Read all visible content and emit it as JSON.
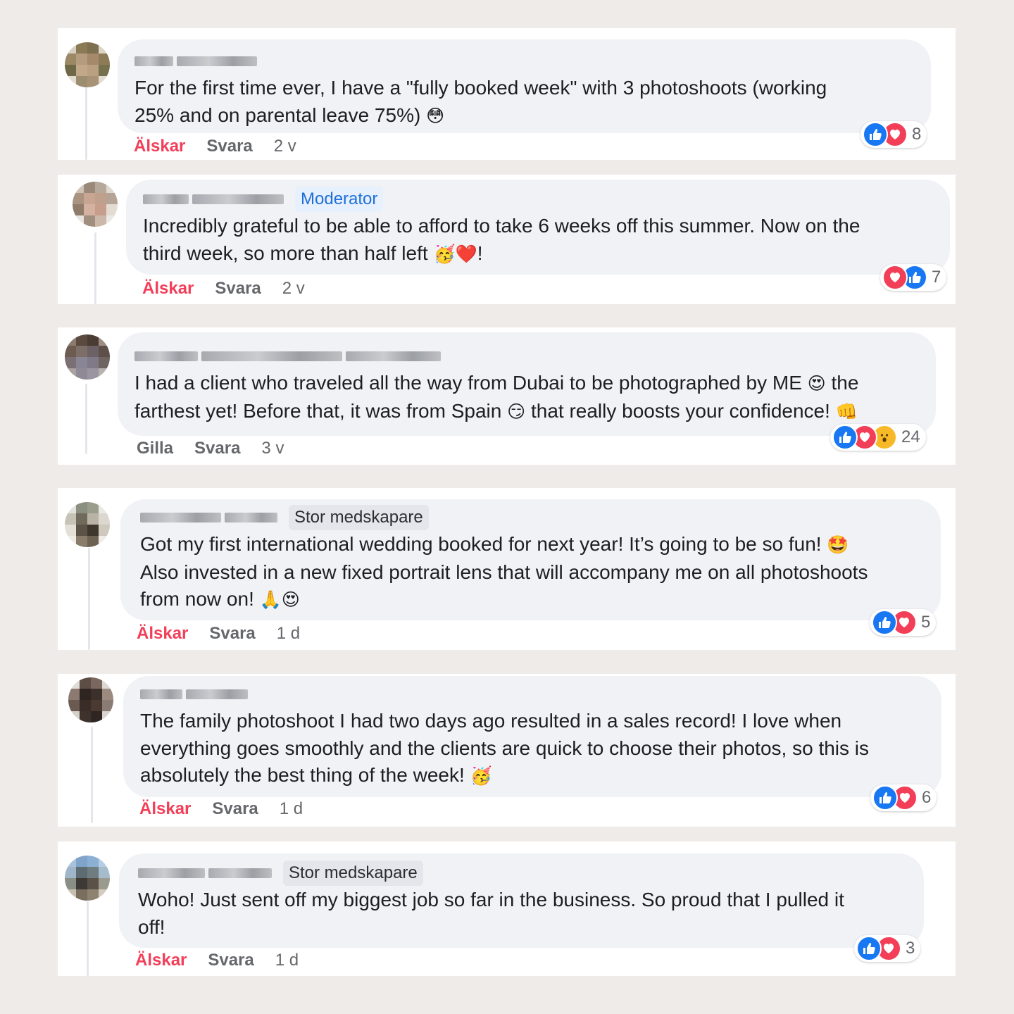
{
  "labels": {
    "love": "Älskar",
    "like": "Gilla",
    "reply": "Svara"
  },
  "colors": {
    "page_bg": "#efebe9",
    "bubble_bg": "#f0f2f5",
    "love_text": "#f33e58",
    "like_blue": "#1877f2",
    "moderator_text": "#1e6fd9"
  },
  "comments": [
    {
      "badge": "",
      "line1": "For the first time ever, I have a \"fully booked week\" with 3 photoshoots (working",
      "line2": "25% and on parental leave 75%)",
      "line3": "",
      "emoji": [
        "😳"
      ],
      "action": "Älskar",
      "time": "2 v",
      "reaction_icons": [
        "like-icon",
        "heart-icon"
      ],
      "reaction_count": "8"
    },
    {
      "badge": "Moderator",
      "line1": "Incredibly grateful to be able to afford to take 6 weeks off this summer. Now on the",
      "line2": "third week, so more than half left",
      "line3": "",
      "emoji": [
        "🥳",
        "❤️"
      ],
      "trailing": "!",
      "action": "Älskar",
      "time": "2 v",
      "reaction_icons": [
        "heart-icon",
        "like-icon"
      ],
      "reaction_count": "7"
    },
    {
      "badge": "",
      "line1a": "I had a client who traveled all the way from Dubai to be photographed by ME",
      "line1b": "the",
      "line2a": "farthest yet! Before that, it was from Spain",
      "line2b": "that really boosts your confidence!",
      "emoji": [
        "😍",
        "😏",
        "👊"
      ],
      "action": "Gilla",
      "time": "3 v",
      "reaction_icons": [
        "like-icon",
        "heart-icon",
        "wow-icon"
      ],
      "reaction_count": "24"
    },
    {
      "badge": "Stor medskapare",
      "line1": "Got my first international wedding booked for next year! It’s going to be so fun!",
      "line2": "Also invested in a new fixed portrait lens that will accompany me on all photoshoots",
      "line3": "from now on!",
      "emoji": [
        "🤩",
        "🙏",
        "😍"
      ],
      "action": "Älskar",
      "time": "1 d",
      "reaction_icons": [
        "like-icon",
        "heart-icon"
      ],
      "reaction_count": "5"
    },
    {
      "badge": "",
      "line1": "The family photoshoot I had two days ago resulted in a sales record! I love when",
      "line2": "everything goes smoothly and the clients are quick to choose their photos, so this is",
      "line3": "absolutely the best thing of the week!",
      "emoji": [
        "🥳"
      ],
      "action": "Älskar",
      "time": "1 d",
      "reaction_icons": [
        "like-icon",
        "heart-icon"
      ],
      "reaction_count": "6"
    },
    {
      "badge": "Stor medskapare",
      "line1": "Woho! Just sent off my biggest job so far in the business. So proud that I pulled it",
      "line2": "off!",
      "line3": "",
      "emoji": [],
      "action": "Älskar",
      "time": "1 d",
      "reaction_icons": [
        "like-icon",
        "heart-icon"
      ],
      "reaction_count": "3"
    }
  ]
}
